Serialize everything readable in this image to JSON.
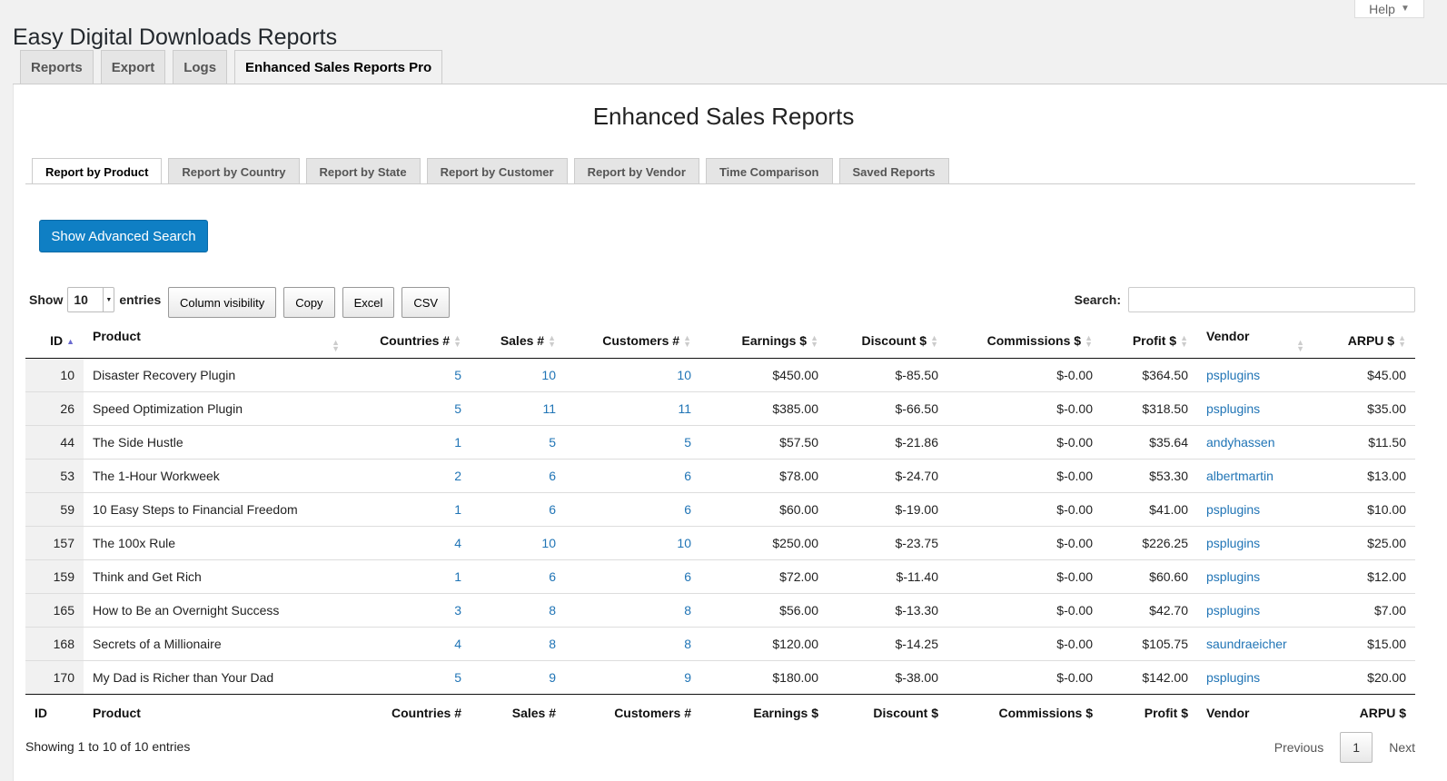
{
  "header": {
    "title": "Easy Digital Downloads Reports",
    "help_label": "Help"
  },
  "main_tabs": [
    {
      "label": "Reports"
    },
    {
      "label": "Export"
    },
    {
      "label": "Logs"
    },
    {
      "label": "Enhanced Sales Reports Pro",
      "active": true
    }
  ],
  "section": {
    "heading": "Enhanced Sales Reports"
  },
  "sub_tabs": [
    {
      "label": "Report by Product",
      "active": true
    },
    {
      "label": "Report by Country"
    },
    {
      "label": "Report by State"
    },
    {
      "label": "Report by Customer"
    },
    {
      "label": "Report by Vendor"
    },
    {
      "label": "Time Comparison"
    },
    {
      "label": "Saved Reports"
    }
  ],
  "advanced_search_label": "Show Advanced Search",
  "length": {
    "show_label": "Show",
    "value": "10",
    "entries_label": "entries"
  },
  "table_buttons": [
    "Column visibility",
    "Copy",
    "Excel",
    "CSV"
  ],
  "search": {
    "label": "Search:",
    "value": ""
  },
  "columns": [
    "ID",
    "Product",
    "Countries #",
    "Sales #",
    "Customers #",
    "Earnings $",
    "Discount $",
    "Commissions $",
    "Profit $",
    "Vendor",
    "ARPU $"
  ],
  "rows": [
    {
      "id": "10",
      "product": "Disaster Recovery Plugin",
      "countries": "5",
      "sales": "10",
      "customers": "10",
      "earnings": "$450.00",
      "discount": "$-85.50",
      "commissions": "$-0.00",
      "profit": "$364.50",
      "vendor": "psplugins",
      "arpu": "$45.00"
    },
    {
      "id": "26",
      "product": "Speed Optimization Plugin",
      "countries": "5",
      "sales": "11",
      "customers": "11",
      "earnings": "$385.00",
      "discount": "$-66.50",
      "commissions": "$-0.00",
      "profit": "$318.50",
      "vendor": "psplugins",
      "arpu": "$35.00"
    },
    {
      "id": "44",
      "product": "The Side Hustle",
      "countries": "1",
      "sales": "5",
      "customers": "5",
      "earnings": "$57.50",
      "discount": "$-21.86",
      "commissions": "$-0.00",
      "profit": "$35.64",
      "vendor": "andyhassen",
      "arpu": "$11.50"
    },
    {
      "id": "53",
      "product": "The 1-Hour Workweek",
      "countries": "2",
      "sales": "6",
      "customers": "6",
      "earnings": "$78.00",
      "discount": "$-24.70",
      "commissions": "$-0.00",
      "profit": "$53.30",
      "vendor": "albertmartin",
      "arpu": "$13.00"
    },
    {
      "id": "59",
      "product": "10 Easy Steps to Financial Freedom",
      "countries": "1",
      "sales": "6",
      "customers": "6",
      "earnings": "$60.00",
      "discount": "$-19.00",
      "commissions": "$-0.00",
      "profit": "$41.00",
      "vendor": "psplugins",
      "arpu": "$10.00"
    },
    {
      "id": "157",
      "product": "The 100x Rule",
      "countries": "4",
      "sales": "10",
      "customers": "10",
      "earnings": "$250.00",
      "discount": "$-23.75",
      "commissions": "$-0.00",
      "profit": "$226.25",
      "vendor": "psplugins",
      "arpu": "$25.00"
    },
    {
      "id": "159",
      "product": "Think and Get Rich",
      "countries": "1",
      "sales": "6",
      "customers": "6",
      "earnings": "$72.00",
      "discount": "$-11.40",
      "commissions": "$-0.00",
      "profit": "$60.60",
      "vendor": "psplugins",
      "arpu": "$12.00"
    },
    {
      "id": "165",
      "product": "How to Be an Overnight Success",
      "countries": "3",
      "sales": "8",
      "customers": "8",
      "earnings": "$56.00",
      "discount": "$-13.30",
      "commissions": "$-0.00",
      "profit": "$42.70",
      "vendor": "psplugins",
      "arpu": "$7.00"
    },
    {
      "id": "168",
      "product": "Secrets of a Millionaire",
      "countries": "4",
      "sales": "8",
      "customers": "8",
      "earnings": "$120.00",
      "discount": "$-14.25",
      "commissions": "$-0.00",
      "profit": "$105.75",
      "vendor": "saundraeicher",
      "arpu": "$15.00"
    },
    {
      "id": "170",
      "product": "My Dad is Richer than Your Dad",
      "countries": "5",
      "sales": "9",
      "customers": "9",
      "earnings": "$180.00",
      "discount": "$-38.00",
      "commissions": "$-0.00",
      "profit": "$142.00",
      "vendor": "psplugins",
      "arpu": "$20.00"
    }
  ],
  "info_text": "Showing 1 to 10 of 10 entries",
  "pagination": {
    "previous": "Previous",
    "current": "1",
    "next": "Next"
  },
  "colors": {
    "accent": "#0f7fc4",
    "link": "#2175b6"
  }
}
